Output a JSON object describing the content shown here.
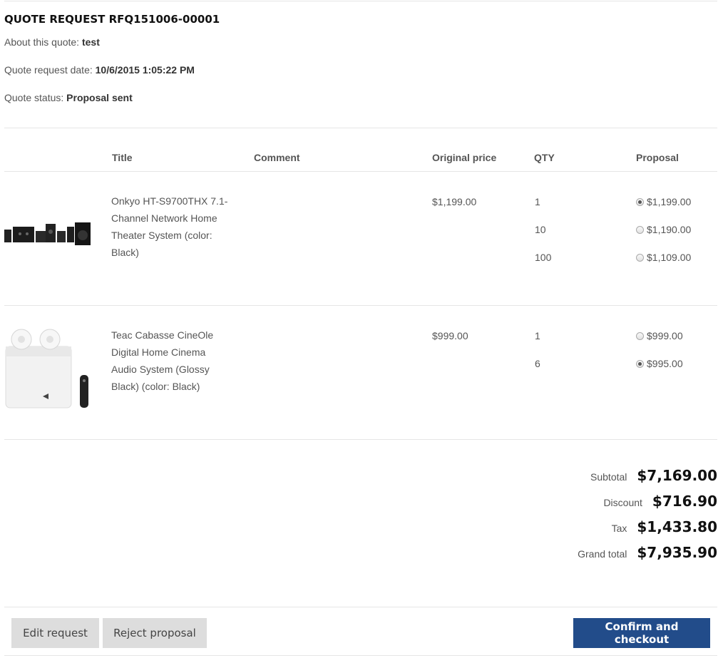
{
  "quote": {
    "title": "QUOTE REQUEST RFQ151006-00001",
    "about_label": "About this quote: ",
    "about_value": "test",
    "date_label": "Quote request date: ",
    "date_value": "10/6/2015 1:05:22 PM",
    "status_label": "Quote status: ",
    "status_value": "Proposal sent"
  },
  "table": {
    "headers": {
      "title": "Title",
      "comment": "Comment",
      "original_price": "Original price",
      "qty": "QTY",
      "proposal": "Proposal"
    },
    "rows": [
      {
        "title": "Onkyo HT-S9700THX 7.1-Channel Network Home Theater System (color: Black)",
        "comment": "",
        "original_price": "$1,199.00",
        "image_icon": "home-theater-speakers-image",
        "tiers": [
          {
            "qty": "1",
            "price": "$1,199.00",
            "selected": true
          },
          {
            "qty": "10",
            "price": "$1,190.00",
            "selected": false
          },
          {
            "qty": "100",
            "price": "$1,109.00",
            "selected": false
          }
        ]
      },
      {
        "title": "Teac Cabasse CineOle Digital Home Cinema Audio System (Glossy Black) (color: Black)",
        "comment": "",
        "original_price": "$999.00",
        "image_icon": "cinema-audio-system-image",
        "tiers": [
          {
            "qty": "1",
            "price": "$999.00",
            "selected": false
          },
          {
            "qty": "6",
            "price": "$995.00",
            "selected": true
          }
        ]
      }
    ]
  },
  "totals": {
    "subtotal_label": "Subtotal",
    "subtotal": "$7,169.00",
    "discount_label": "Discount",
    "discount": "$716.90",
    "tax_label": "Tax",
    "tax": "$1,433.80",
    "grand_total_label": "Grand total",
    "grand_total": "$7,935.90"
  },
  "actions": {
    "edit": "Edit request",
    "reject": "Reject proposal",
    "confirm": "Confirm and checkout"
  },
  "colors": {
    "primary_button": "#224c8a",
    "secondary_button": "#dddddd"
  }
}
